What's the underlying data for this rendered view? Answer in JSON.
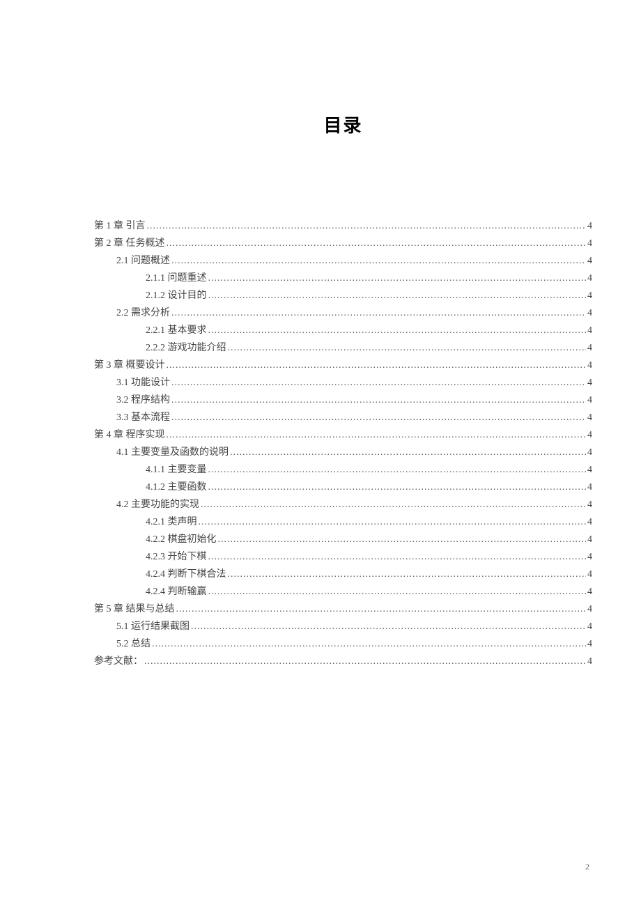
{
  "title": "目录",
  "pageNumber": "2",
  "toc": [
    {
      "level": 0,
      "label": "第 1 章  引言",
      "page": "4"
    },
    {
      "level": 0,
      "label": "第 2 章  任务概述",
      "page": "4"
    },
    {
      "level": 1,
      "label": "2.1 问题概述",
      "page": "4"
    },
    {
      "level": 2,
      "label": "2.1.1 问题重述",
      "page": "4"
    },
    {
      "level": 2,
      "label": "2.1.2 设计目的",
      "page": "4"
    },
    {
      "level": 1,
      "label": "2.2 需求分析",
      "page": "4"
    },
    {
      "level": 2,
      "label": "2.2.1 基本要求",
      "page": "4"
    },
    {
      "level": 2,
      "label": "2.2.2 游戏功能介绍",
      "page": "4"
    },
    {
      "level": 0,
      "label": "第 3 章  概要设计",
      "page": "4"
    },
    {
      "level": 1,
      "label": "3.1 功能设计",
      "page": "4"
    },
    {
      "level": 1,
      "label": "3.2 程序结构",
      "page": "4"
    },
    {
      "level": 1,
      "label": "3.3 基本流程",
      "page": "4"
    },
    {
      "level": 0,
      "label": "第 4 章  程序实现",
      "page": "4"
    },
    {
      "level": 1,
      "label": "4.1 主要变量及函数的说明",
      "page": "4"
    },
    {
      "level": 2,
      "label": "4.1.1 主要变量",
      "page": "4"
    },
    {
      "level": 2,
      "label": "4.1.2 主要函数",
      "page": "4"
    },
    {
      "level": 1,
      "label": "4.2 主要功能的实现",
      "page": "4"
    },
    {
      "level": 2,
      "label": "4.2.1 类声明",
      "page": "4"
    },
    {
      "level": 2,
      "label": "4.2.2 棋盘初始化",
      "page": "4"
    },
    {
      "level": 2,
      "label": "4.2.3 开始下棋",
      "page": "4"
    },
    {
      "level": 2,
      "label": "4.2.4 判断下棋合法",
      "page": "4"
    },
    {
      "level": 2,
      "label": "4.2.4 判断输赢",
      "page": "4"
    },
    {
      "level": 0,
      "label": "第 5 章  结果与总结",
      "page": "4"
    },
    {
      "level": 1,
      "label": "5.1 运行结果截图",
      "page": "4"
    },
    {
      "level": 1,
      "label": "5.2 总结",
      "page": "4"
    },
    {
      "level": 0,
      "label": "参考文献：",
      "page": "4"
    }
  ]
}
